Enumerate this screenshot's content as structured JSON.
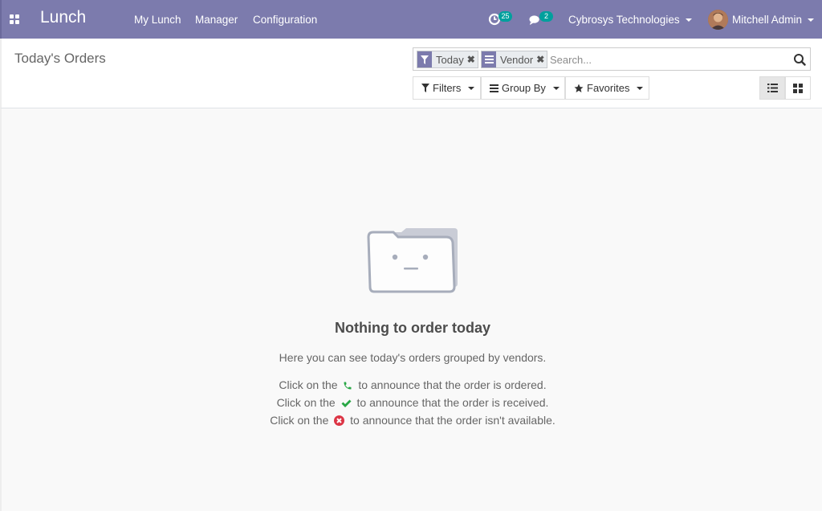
{
  "navbar": {
    "app_name": "Lunch",
    "menu": [
      "My Lunch",
      "Manager",
      "Configuration"
    ],
    "activity_count": "25",
    "message_count": "2",
    "company": "Cybrosys Technologies",
    "user": "Mitchell Admin"
  },
  "control_panel": {
    "title": "Today's Orders",
    "facets": [
      {
        "label": "Today",
        "icon": "filter-icon"
      },
      {
        "label": "Vendor",
        "icon": "group-by-icon"
      }
    ],
    "search_placeholder": "Search...",
    "filters_label": "Filters",
    "group_by_label": "Group By",
    "favorites_label": "Favorites",
    "views": [
      "list-view",
      "kanban-view"
    ]
  },
  "helper": {
    "title": "Nothing to order today",
    "subtitle": "Here you can see today's orders grouped by vendors.",
    "line1_pre": "Click on the",
    "line1_post": "to announce that the order is ordered.",
    "line2_pre": "Click on the",
    "line2_post": "to announce that the order is received.",
    "line3_pre": "Click on the",
    "line3_post": "to announce that the order isn't available."
  },
  "colors": {
    "brand": "#7c7bad",
    "badge": "#00a09d",
    "phone_green": "#28a745",
    "check_green": "#28a745",
    "cancel_red": "#dc3545"
  }
}
